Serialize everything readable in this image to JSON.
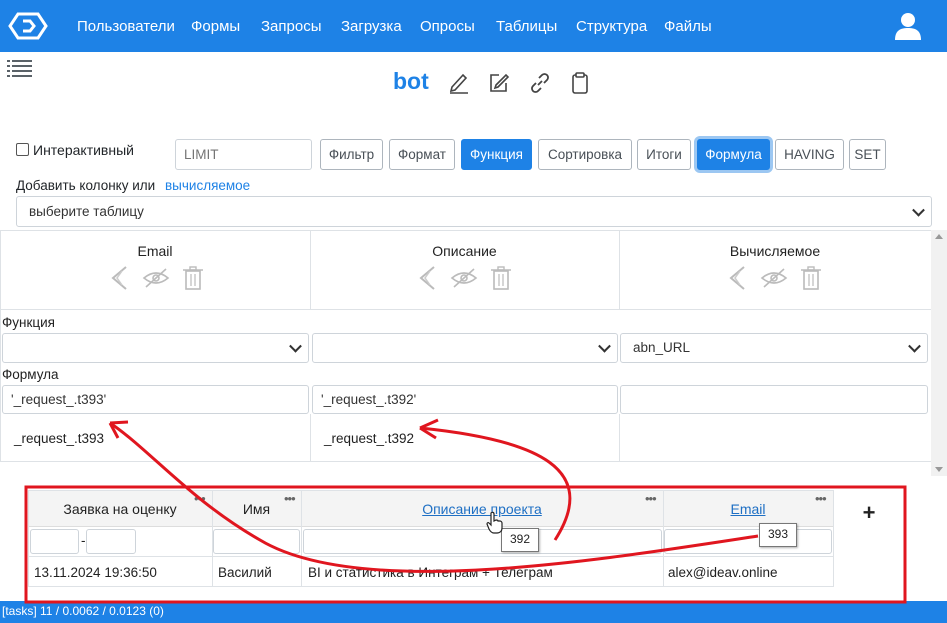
{
  "nav": {
    "items": [
      "Пользователи",
      "Формы",
      "Запросы",
      "Загрузка",
      "Опросы",
      "Таблицы",
      "Структура",
      "Файлы"
    ]
  },
  "page": {
    "title": "bot"
  },
  "controls": {
    "interactive_label": "Интерактивный",
    "limit_placeholder": "LIMIT",
    "buttons": [
      "Фильтр",
      "Формат",
      "Функция",
      "Сортировка",
      "Итоги",
      "Формула",
      "HAVING",
      "SET"
    ],
    "add_column_text": "Добавить колонку или",
    "add_column_link": "вычисляемое",
    "table_select": "выберите таблицу"
  },
  "columns": [
    {
      "name": "Email",
      "function": "",
      "formula": "'_request_.t393'",
      "alias": "_request_.t393"
    },
    {
      "name": "Описание",
      "function": "",
      "formula": "'_request_.t392'",
      "alias": "_request_.t392"
    },
    {
      "name": "Вычисляемое",
      "function": "abn_URL",
      "formula": "",
      "alias": ""
    }
  ],
  "labels": {
    "function": "Функция",
    "formula": "Формула"
  },
  "result": {
    "headers": [
      "Заявка на оценку",
      "Имя",
      "Описание проекта",
      "Email"
    ],
    "add": "+",
    "date_sep": "-",
    "row": [
      "13.11.2024 19:36:50",
      "Василий",
      "BI и статистика в Интеграм + Телеграм",
      "alex@ideav.online"
    ],
    "tooltips": [
      "392",
      "393"
    ]
  },
  "status": "[tasks] 11 / 0.0062 / 0.0123 (0)",
  "colors": {
    "brand": "#1e82e6",
    "annotation": "#e0161f"
  }
}
